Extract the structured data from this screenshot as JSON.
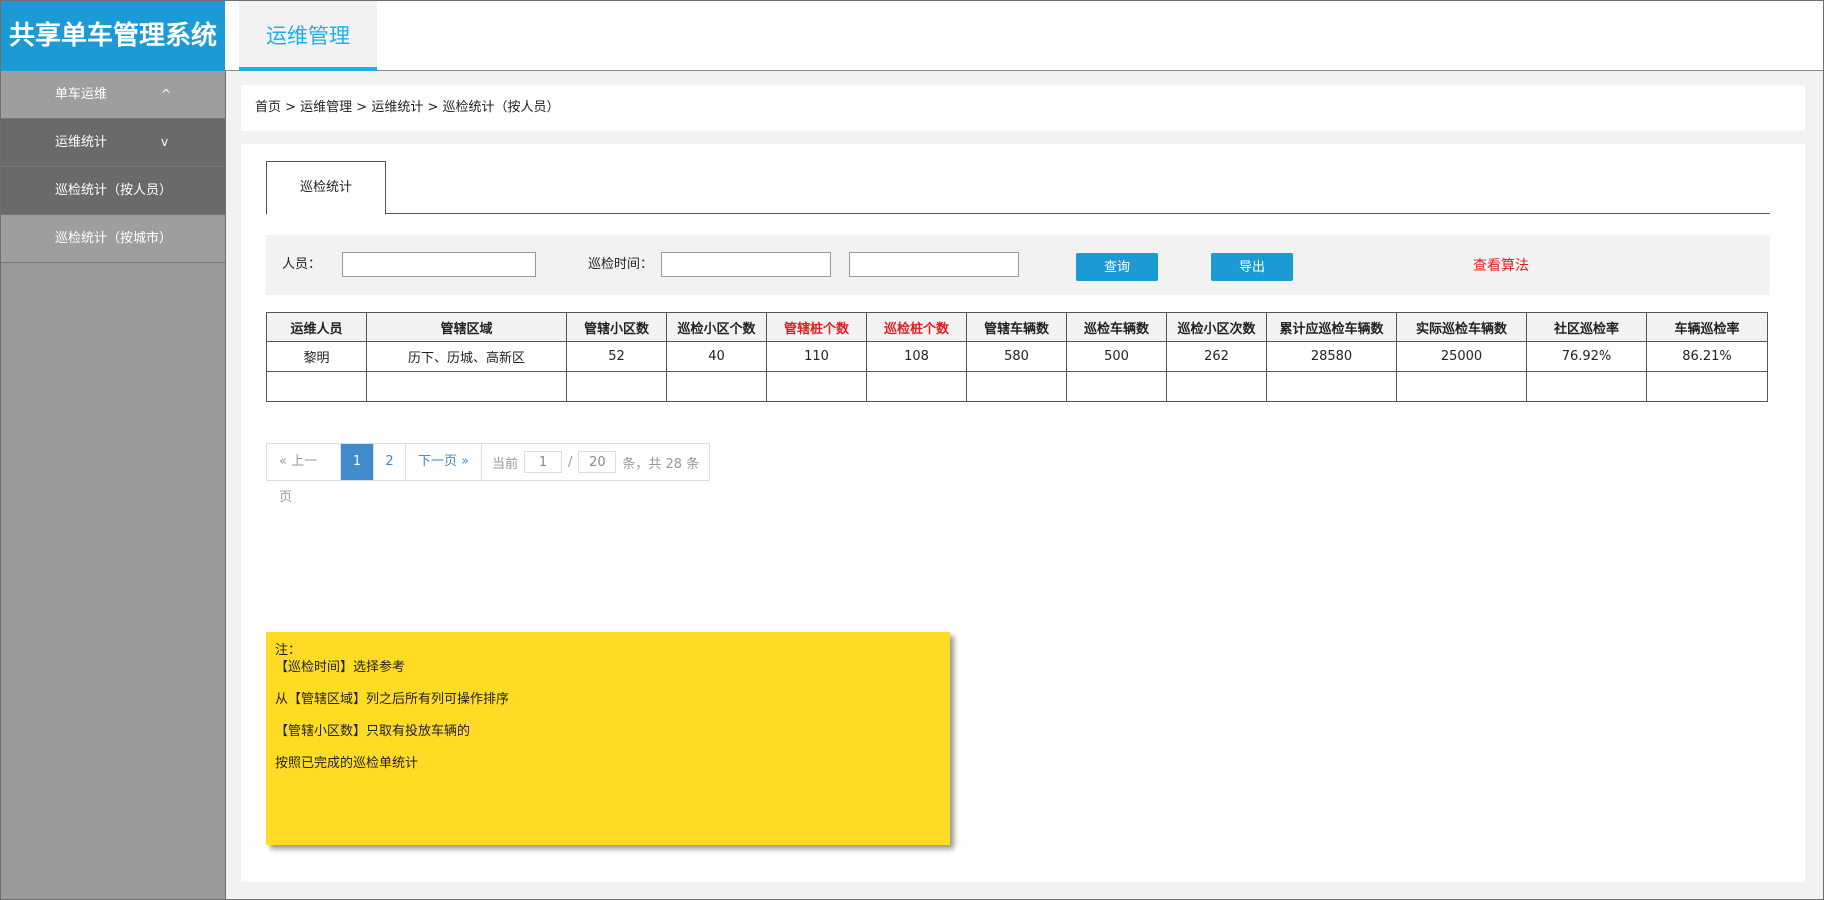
{
  "app": {
    "title": "共享单车管理系统",
    "top_tab": "运维管理"
  },
  "sidebar": {
    "items": [
      {
        "label": "单车运维",
        "arrow": "^"
      },
      {
        "label": "运维统计",
        "arrow": "v"
      },
      {
        "label": "巡检统计（按人员）"
      },
      {
        "label": "巡检统计（按城市）"
      }
    ]
  },
  "breadcrumb": "首页 > 运维管理 > 运维统计 > 巡检统计（按人员）",
  "tab": "巡检统计",
  "filter": {
    "person_label": "人员：",
    "person_value": "",
    "time_label": "巡检时间：",
    "time_from": "",
    "time_to": "",
    "query_btn": "查询",
    "export_btn": "导出",
    "algo_link": "查看算法"
  },
  "colors": {
    "brand": "#1b9ad6",
    "red_header": "#e02020",
    "note_bg": "#fedb24"
  },
  "table": {
    "headers": [
      "运维人员",
      "管辖区域",
      "管辖小区数",
      "巡检小区个数",
      "管辖桩个数",
      "巡检桩个数",
      "管辖车辆数",
      "巡检车辆数",
      "巡检小区次数",
      "累计应巡检车辆数",
      "实际巡检车辆数",
      "社区巡检率",
      "车辆巡检率"
    ],
    "rows": [
      [
        "黎明",
        "历下、历城、高新区",
        "52",
        "40",
        "110",
        "108",
        "580",
        "500",
        "262",
        "28580",
        "25000",
        "76.92%",
        "86.21%"
      ],
      [
        "",
        "",
        "",
        "",
        "",
        "",
        "",
        "",
        "",
        "",
        "",
        "",
        ""
      ]
    ]
  },
  "pager": {
    "prev": "« 上一页",
    "pages": [
      "1",
      "2"
    ],
    "next": "下一页 »",
    "current_label": "当前",
    "current": "1",
    "sep": "/",
    "size": "20",
    "total_text": "条，共 28 条"
  },
  "note": {
    "lines": [
      "注：",
      "【巡检时间】选择参考",
      "从【管辖区域】列之后所有列可操作排序",
      "【管辖小区数】只取有投放车辆的",
      "按照已完成的巡检单统计"
    ]
  }
}
